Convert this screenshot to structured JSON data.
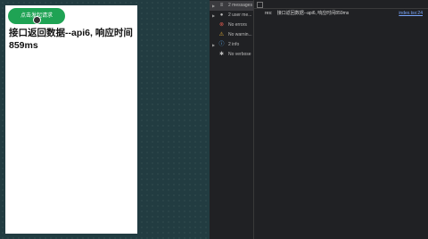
{
  "phone": {
    "button_label": "点击发起请求",
    "result_text": "接口返回数据--api6, 响应时间859ms"
  },
  "devtools": {
    "sidebar": [
      {
        "label": "2 messages",
        "icon": "list-icon",
        "active": true
      },
      {
        "label": "2 user me...",
        "icon": "user-icon"
      },
      {
        "label": "No errors",
        "icon": "error-icon",
        "color": "#e05a4f"
      },
      {
        "label": "No warnin...",
        "icon": "warning-icon",
        "color": "#e8b339"
      },
      {
        "label": "2 info",
        "icon": "info-icon",
        "color": "#5aa9e6"
      },
      {
        "label": "No verbose",
        "icon": "bug-icon"
      }
    ],
    "log": {
      "prefix": "res:",
      "message": "接口返回数据--api6, 响应时间859ms",
      "source": "index.tsx:24"
    }
  }
}
